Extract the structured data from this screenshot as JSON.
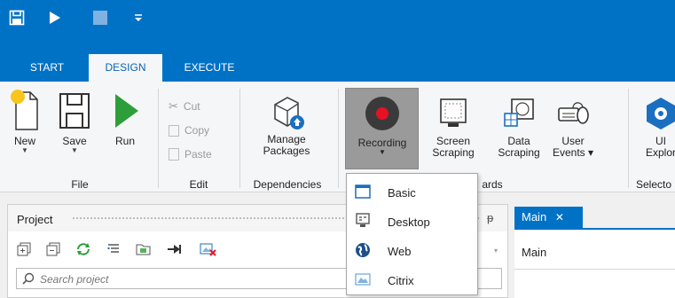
{
  "quick_access": {
    "icons": [
      "save-icon",
      "run-icon",
      "stop-icon",
      "customize-icon"
    ]
  },
  "tabs": [
    {
      "label": "START",
      "active": false
    },
    {
      "label": "DESIGN",
      "active": true
    },
    {
      "label": "EXECUTE",
      "active": false
    }
  ],
  "ribbon": {
    "file": {
      "new_label": "New",
      "save_label": "Save",
      "run_label": "Run",
      "group_label": "File"
    },
    "edit": {
      "cut_label": "Cut",
      "copy_label": "Copy",
      "paste_label": "Paste",
      "group_label": "Edit"
    },
    "dependencies": {
      "manage_label_1": "Manage",
      "manage_label_2": "Packages",
      "group_label": "Dependencies"
    },
    "wizards": {
      "recording_label": "Recording",
      "screen_label_1": "Screen",
      "screen_label_2": "Scraping",
      "data_label_1": "Data",
      "data_label_2": "Scraping",
      "user_label_1": "User",
      "user_label_2": "Events",
      "group_label_partial": "ards"
    },
    "selectors": {
      "ui_label_1": "UI",
      "ui_label_2": "Explor",
      "group_label": "Selecto"
    }
  },
  "recording_menu": [
    {
      "label": "Basic",
      "icon": "window-icon"
    },
    {
      "label": "Desktop",
      "icon": "desktop-icon"
    },
    {
      "label": "Web",
      "icon": "globe-icon"
    },
    {
      "label": "Citrix",
      "icon": "citrix-icon"
    }
  ],
  "project_panel": {
    "title": "Project",
    "search_placeholder": "Search project"
  },
  "document": {
    "tab_label": "Main",
    "close_glyph": "✕",
    "content_title": "Main"
  },
  "colors": {
    "accent": "#0072c6",
    "run_green": "#2e9e3a",
    "record_red": "#e81123"
  }
}
